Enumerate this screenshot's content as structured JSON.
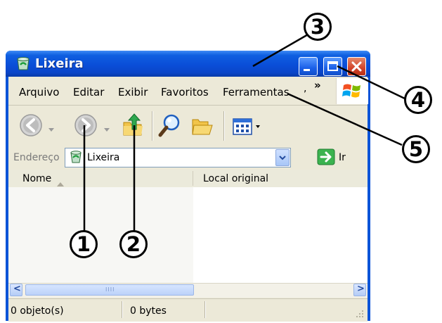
{
  "window": {
    "title": "Lixeira",
    "title_icon": "recycle-bin-icon",
    "controls": [
      "minimize-icon",
      "maximize-icon",
      "close-icon"
    ]
  },
  "menu": {
    "items": [
      "Arquivo",
      "Editar",
      "Exibir",
      "Favoritos",
      "Ferramentas"
    ],
    "overflow": "»",
    "overflow_dot": ","
  },
  "toolbar": {
    "buttons": [
      "back-arrow-icon",
      "dropdown-arrow-icon",
      "forward-arrow-icon",
      "dropdown-arrow-icon",
      "up-folder-icon",
      "search-icon",
      "folders-icon",
      "views-icon"
    ]
  },
  "address": {
    "label": "Endereço",
    "value": "Lixeira",
    "go_label": "Ir"
  },
  "columns": {
    "name": "Nome",
    "original_location": "Local original"
  },
  "scroll": {
    "left": "<",
    "right": ">",
    "grip": "IIII"
  },
  "status": {
    "objects": "0 objeto(s)",
    "size": "0 bytes"
  },
  "callouts": [
    "1",
    "2",
    "3",
    "4",
    "5"
  ]
}
